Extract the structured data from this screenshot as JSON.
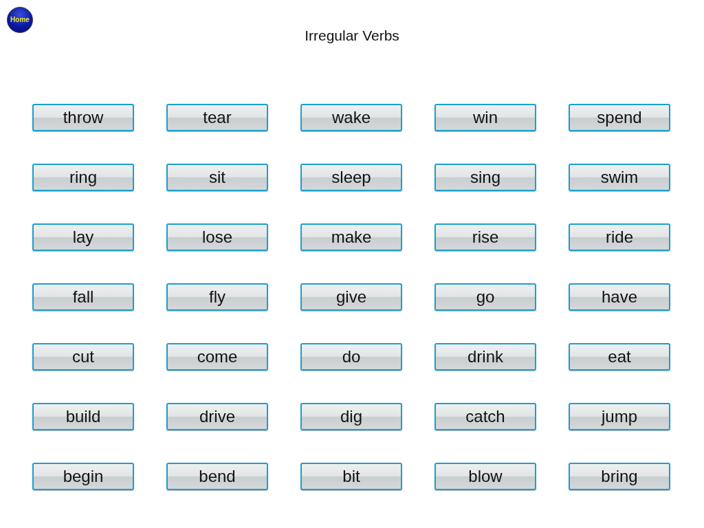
{
  "home_button": {
    "label": "Home"
  },
  "title": "Irregular Verbs",
  "verbs": [
    "throw",
    "tear",
    "wake",
    "win",
    "spend",
    "ring",
    "sit",
    "sleep",
    "sing",
    "swim",
    "lay",
    "lose",
    "make",
    "rise",
    "ride",
    "fall",
    "fly",
    "give",
    "go",
    "have",
    "cut",
    "come",
    "do",
    "drink",
    "eat",
    "build",
    "drive",
    "dig",
    "catch",
    "jump",
    "begin",
    "bend",
    "bit",
    "blow",
    "bring"
  ]
}
